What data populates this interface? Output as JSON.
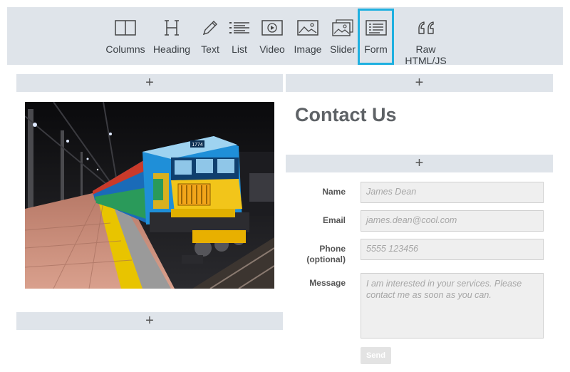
{
  "toolbar": {
    "items": [
      {
        "label": "Columns",
        "icon": "columns-icon"
      },
      {
        "label": "Heading",
        "icon": "heading-icon"
      },
      {
        "label": "Text",
        "icon": "pen-icon"
      },
      {
        "label": "List",
        "icon": "list-icon"
      },
      {
        "label": "Video",
        "icon": "video-icon"
      },
      {
        "label": "Image",
        "icon": "image-icon"
      },
      {
        "label": "Slider",
        "icon": "slider-icon"
      },
      {
        "label": "Form",
        "icon": "form-icon",
        "active": true
      },
      {
        "label": "Raw HTML/JS",
        "icon": "quote-icon"
      }
    ],
    "active_color": "#1fb0e0"
  },
  "add_symbol": "+",
  "heading": "Contact Us",
  "photo": {
    "number_board": "1774"
  },
  "form": {
    "fields": [
      {
        "label": "Name",
        "placeholder": "James Dean"
      },
      {
        "label": "Email",
        "placeholder": "james.dean@cool.com"
      },
      {
        "label": "Phone (optional)",
        "placeholder": "5555 123456"
      },
      {
        "label": "Message",
        "placeholder": "I am interested in your services. Please contact me as soon as you can."
      }
    ],
    "submit_label": "Send"
  }
}
